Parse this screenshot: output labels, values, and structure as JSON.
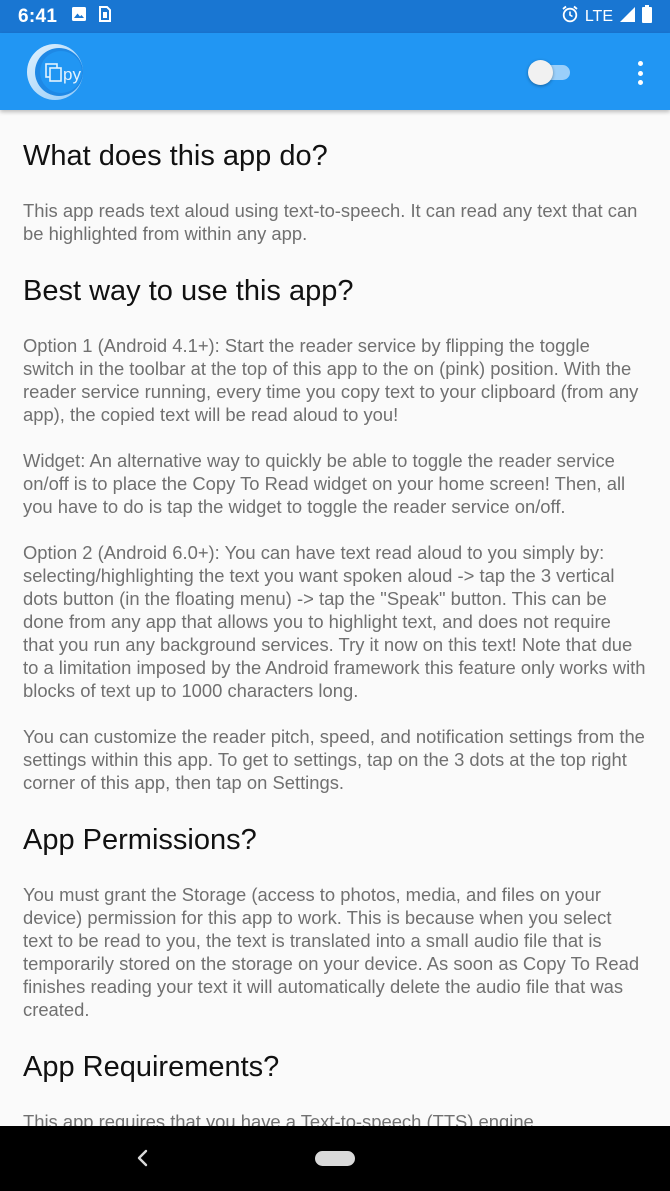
{
  "status_bar": {
    "time": "6:41",
    "network": "LTE",
    "icons": [
      "image-icon",
      "sim-card-icon",
      "alarm-icon",
      "signal-icon",
      "battery-icon"
    ]
  },
  "app_bar": {
    "logo_text": "py",
    "toggle_state": "off",
    "colors": {
      "app_bar": "#2196f3",
      "status_bar": "#1976d2"
    }
  },
  "content": {
    "sections": [
      {
        "heading": "What does this app do?",
        "paragraphs": [
          "This app reads text aloud using text-to-speech. It can read any text that can be highlighted from within any app."
        ]
      },
      {
        "heading": "Best way to use this app?",
        "paragraphs": [
          "Option 1 (Android 4.1+): Start the reader service by flipping the toggle switch in the toolbar at the top of this app to the on (pink) position. With the reader service running, every time you copy text to your clipboard (from any app), the copied text will be read aloud to you!",
          "Widget: An alternative way to quickly be able to toggle the reader service on/off is to place the Copy To Read widget on your home screen! Then, all you have to do is tap the widget to toggle the reader service on/off.",
          "Option 2 (Android 6.0+): You can have text read aloud to you simply by: selecting/highlighting the text you want spoken aloud -> tap the 3 vertical dots button (in the floating menu) -> tap the \"Speak\" button. This can be done from any app that allows you to highlight text, and does not require that you run any background services. Try it now on this text! Note that due to a limitation imposed by the Android framework this feature only works with blocks of text up to 1000 characters long.",
          "You can customize the reader pitch, speed, and notification settings from the settings within this app. To get to settings, tap on the 3 dots at the top right corner of this app, then tap on Settings."
        ]
      },
      {
        "heading": "App Permissions?",
        "paragraphs": [
          "You must grant the Storage (access to photos, media, and files on your device) permission for this app to work. This is because when you select text to be read to you, the text is translated into a small audio file that is temporarily stored on the storage on your device. As soon as Copy To Read finishes reading your text it will automatically delete the audio file that was created."
        ]
      },
      {
        "heading": "App Requirements?",
        "paragraphs": [
          "This app requires that you have a Text-to-speech (TTS) engine"
        ]
      }
    ]
  }
}
